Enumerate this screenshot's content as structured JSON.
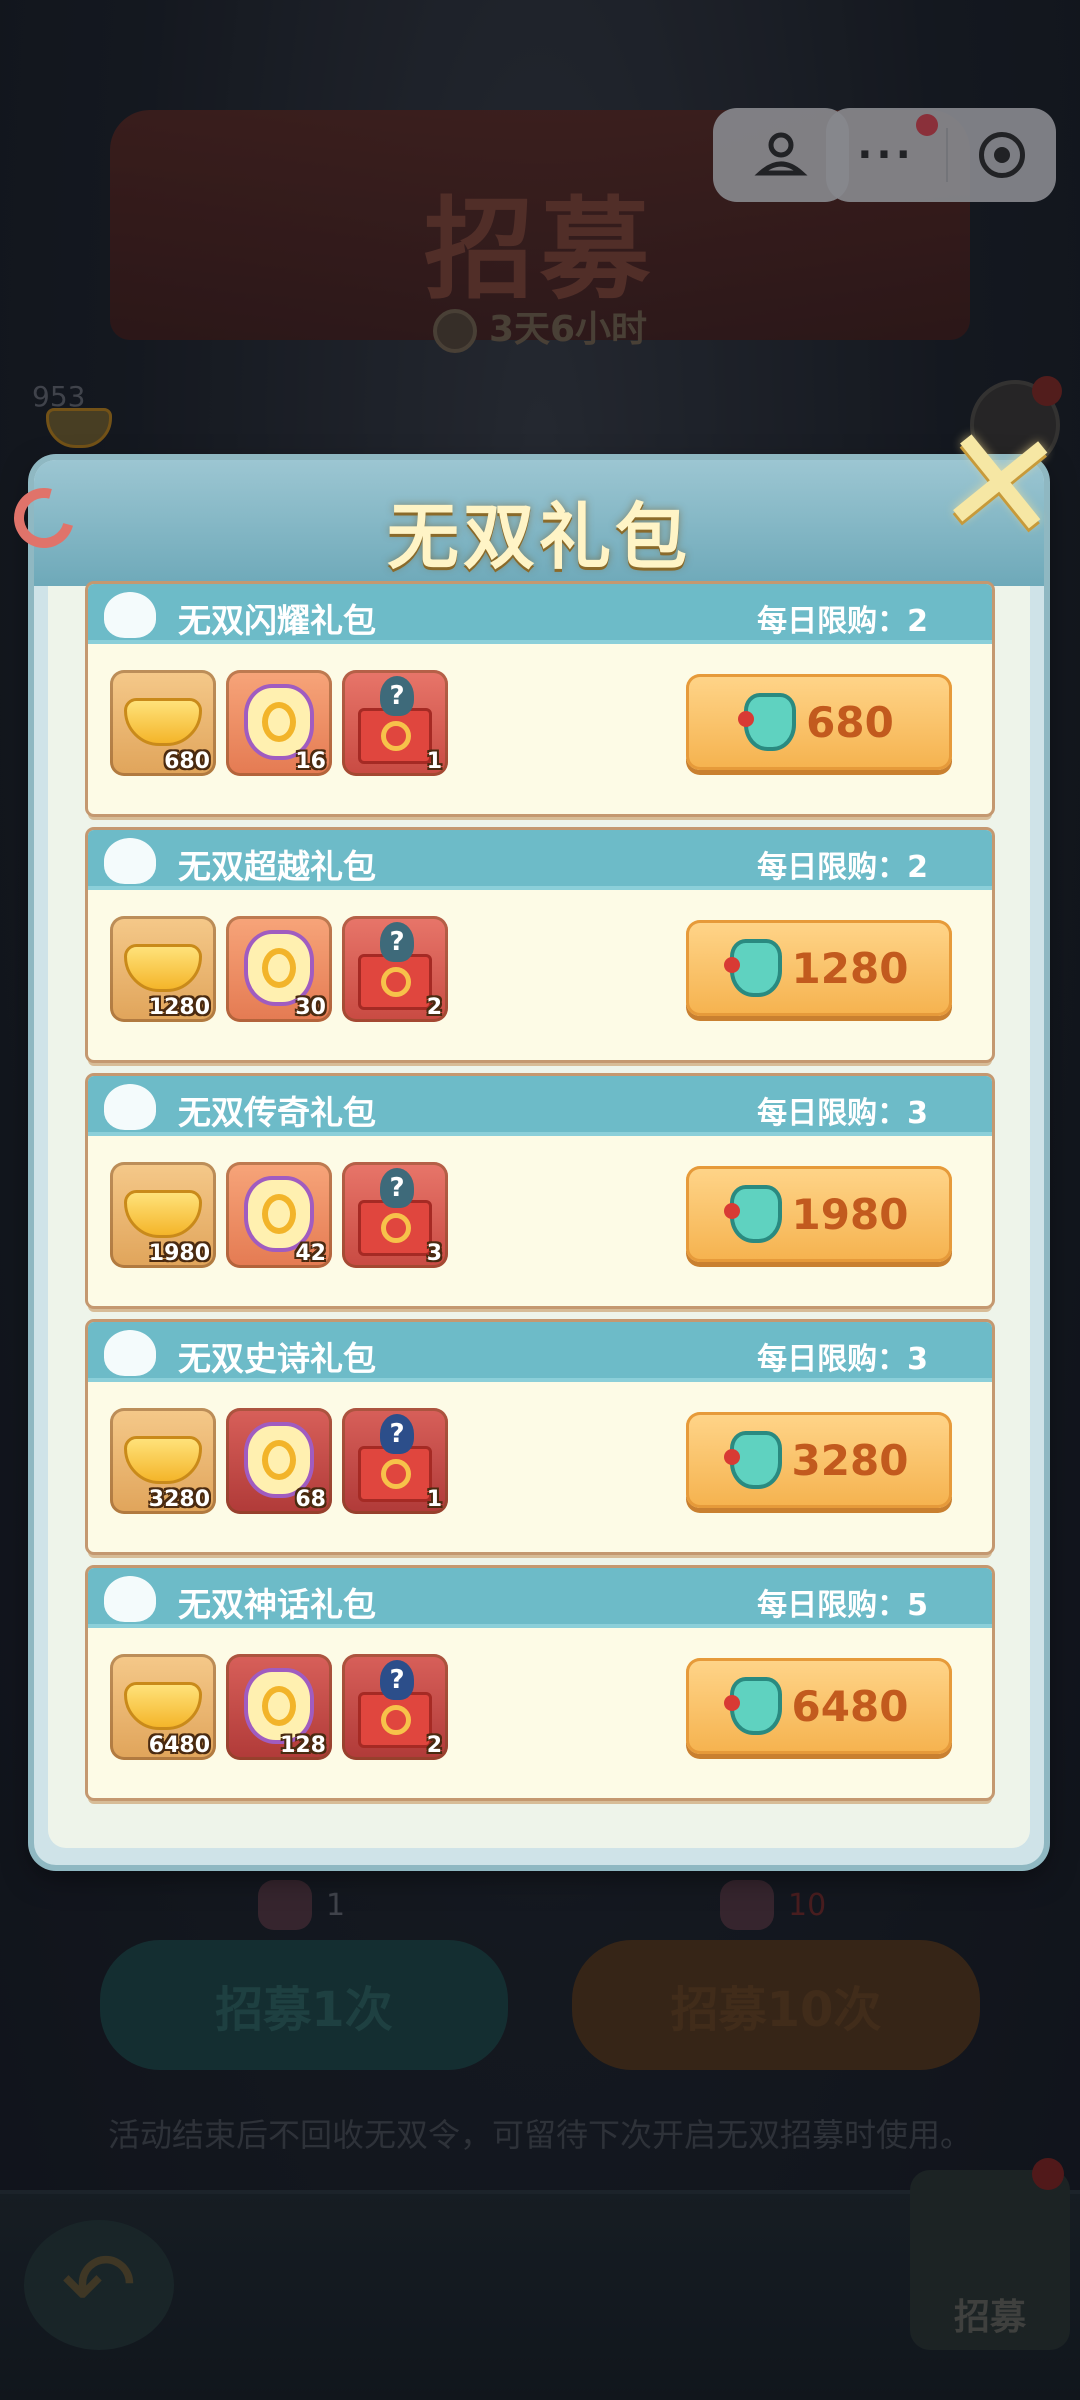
{
  "background": {
    "title": "招募",
    "timer": "3天6小时",
    "currency_amount": "953",
    "cost_single": "1",
    "cost_ten": "10",
    "recruit_once": "招募1次",
    "recruit_ten": "招募10次",
    "notice": "活动结束后不回收无双令，可留待下次开启无双招募时使用。",
    "nav_recruit": "招募"
  },
  "capsule": {
    "more": "···"
  },
  "dialog": {
    "title": "无双礼包",
    "close_icon": "close-icon",
    "packs": [
      {
        "name": "无双闪耀礼包",
        "limit": "每日限购：2",
        "gold": "680",
        "tokens": "16",
        "boxes": "1",
        "price": "680"
      },
      {
        "name": "无双超越礼包",
        "limit": "每日限购：2",
        "gold": "1280",
        "tokens": "30",
        "boxes": "2",
        "price": "1280"
      },
      {
        "name": "无双传奇礼包",
        "limit": "每日限购：3",
        "gold": "1980",
        "tokens": "42",
        "boxes": "3",
        "price": "1980"
      },
      {
        "name": "无双史诗礼包",
        "limit": "每日限购：3",
        "gold": "3280",
        "tokens": "68",
        "boxes": "1",
        "price": "3280"
      },
      {
        "name": "无双神话礼包",
        "limit": "每日限购：5",
        "gold": "6480",
        "tokens": "128",
        "boxes": "2",
        "price": "6480"
      }
    ]
  },
  "colors": {
    "accent_teal": "#6dbbc8",
    "price_orange": "#f5b24e",
    "title_cream": "#fff4c6"
  }
}
